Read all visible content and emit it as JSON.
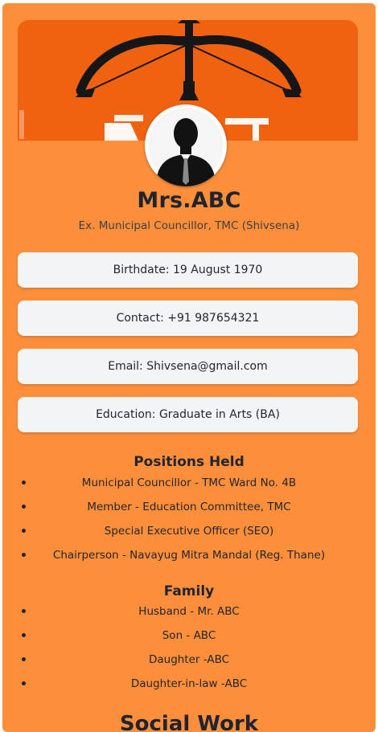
{
  "profile": {
    "name": "Mrs.ABC",
    "title": "Ex. Municipal Councillor, TMC (Shivsena)"
  },
  "info_cards": {
    "birthdate": "Birthdate: 19 August 1970",
    "contact": "Contact: +91 987654321",
    "email": "Email: Shivsena@gmail.com",
    "education": "Education: Graduate in Arts (BA)"
  },
  "positions": {
    "heading": "Positions Held",
    "items": [
      "Municipal Councillor - TMC Ward No. 4B",
      "Member - Education Committee, TMC",
      "Special Executive Officer (SEO)",
      "Chairperson - Navayug Mitra Mandal (Reg. Thane)"
    ]
  },
  "family": {
    "heading": "Family",
    "items": [
      "Husband - Mr. ABC",
      "Son - ABC",
      "Daughter -ABC",
      "Daughter-in-law -ABC"
    ]
  },
  "social": {
    "heading": "Social Work"
  },
  "icons": {
    "banner": "bow-and-arrow-emblem",
    "avatar": "user-silhouette-icon"
  },
  "colors": {
    "card_background": "#fd8f3b",
    "banner_background": "#f0620f",
    "info_card_background": "#f3f4f6",
    "text_primary": "#1f2430"
  }
}
